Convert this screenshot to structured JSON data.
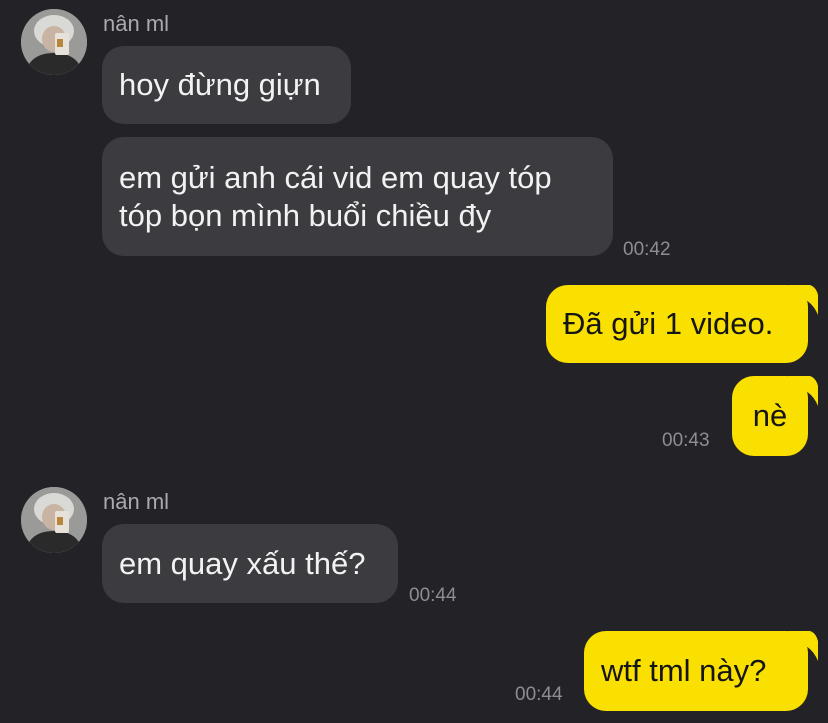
{
  "chat": {
    "theme": {
      "background": "#232327",
      "incoming_bubble": "#3c3c40",
      "outgoing_bubble": "#f9e000",
      "timestamp_color": "#8d8d92",
      "sender_color": "#a9a9ae"
    },
    "groups": [
      {
        "sender": "nân ml",
        "avatar": "profile-photo",
        "messages": [
          {
            "text": "hoy đừng giựn",
            "time": ""
          },
          {
            "lines": [
              "em gửi anh cái vid em quay tóp",
              "tóp bọn mình buổi chiều đy"
            ],
            "time": "00:42"
          }
        ]
      },
      {
        "sender": "me",
        "messages": [
          {
            "text": "Đã gửi 1 video.",
            "time": ""
          },
          {
            "text": "nè",
            "time": "00:43"
          }
        ]
      },
      {
        "sender": "nân ml",
        "avatar": "profile-photo",
        "messages": [
          {
            "text": "em quay xấu thế?",
            "time": "00:44"
          }
        ]
      },
      {
        "sender": "me",
        "messages": [
          {
            "text": "wtf tml này?",
            "time": "00:44"
          }
        ]
      }
    ]
  }
}
